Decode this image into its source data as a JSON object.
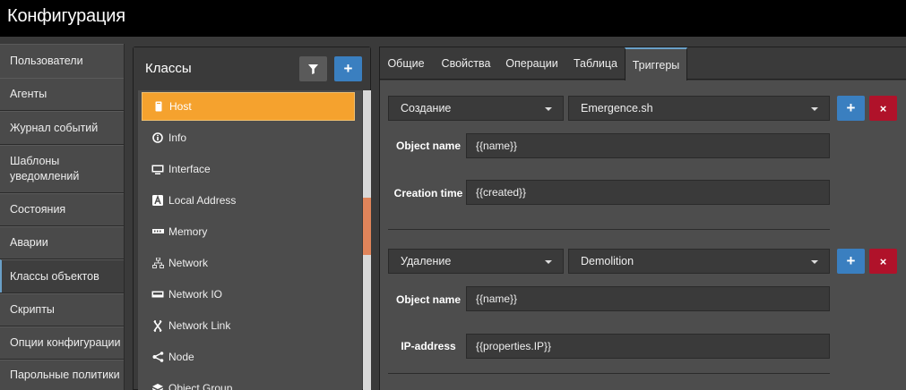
{
  "app": {
    "title": "Конфигурация"
  },
  "nav": {
    "items": [
      {
        "label": "Пользователи"
      },
      {
        "label": "Агенты"
      },
      {
        "label": "Журнал событий"
      },
      {
        "label": "Шаблоны уведомлений"
      },
      {
        "label": "Состояния"
      },
      {
        "label": "Аварии"
      },
      {
        "label": "Классы объектов"
      },
      {
        "label": "Скрипты"
      },
      {
        "label": "Опции конфигурации"
      },
      {
        "label": "Парольные политики"
      }
    ],
    "active": "Классы объектов"
  },
  "classes": {
    "title": "Классы",
    "filter_icon": "filter-icon",
    "add_label": "+",
    "items": [
      {
        "label": "Host",
        "icon": "server-icon",
        "glyph": "▮"
      },
      {
        "label": "Info",
        "icon": "info-icon",
        "glyph": "ⓘ"
      },
      {
        "label": "Interface",
        "icon": "monitor-icon",
        "glyph": "▭"
      },
      {
        "label": "Local Address",
        "icon": "address-icon",
        "glyph": "🅰"
      },
      {
        "label": "Memory",
        "icon": "memory-icon",
        "glyph": "▬"
      },
      {
        "label": "Network",
        "icon": "network-icon",
        "glyph": "⛶"
      },
      {
        "label": "Network IO",
        "icon": "network-card-icon",
        "glyph": "▭"
      },
      {
        "label": "Network Link",
        "icon": "link-icon",
        "glyph": "ᛝ"
      },
      {
        "label": "Node",
        "icon": "node-icon",
        "glyph": "⋖"
      },
      {
        "label": "Object Group",
        "icon": "layers-icon",
        "glyph": "◈"
      }
    ],
    "selected": "Host"
  },
  "tabs": {
    "items": [
      {
        "label": "Общие"
      },
      {
        "label": "Свойства"
      },
      {
        "label": "Операции"
      },
      {
        "label": "Таблица"
      },
      {
        "label": "Триггеры"
      }
    ],
    "active": "Триггеры"
  },
  "triggers": [
    {
      "event": "Создание",
      "script": "Emergence.sh",
      "add_label": "+",
      "delete_label": "×",
      "params": [
        {
          "label": "Object name",
          "value": "{{name}}"
        },
        {
          "label": "Creation time",
          "value": "{{created}}"
        }
      ]
    },
    {
      "event": "Удаление",
      "script": "Demolition",
      "add_label": "+",
      "delete_label": "×",
      "params": [
        {
          "label": "Object name",
          "value": "{{name}}"
        },
        {
          "label": "IP-address",
          "value": "{{properties.IP}}"
        }
      ]
    }
  ],
  "colors": {
    "accent": "#f5a22e",
    "primary": "#3a7fc0",
    "danger": "#b0122a",
    "scroll_thumb": "#e0845a"
  }
}
